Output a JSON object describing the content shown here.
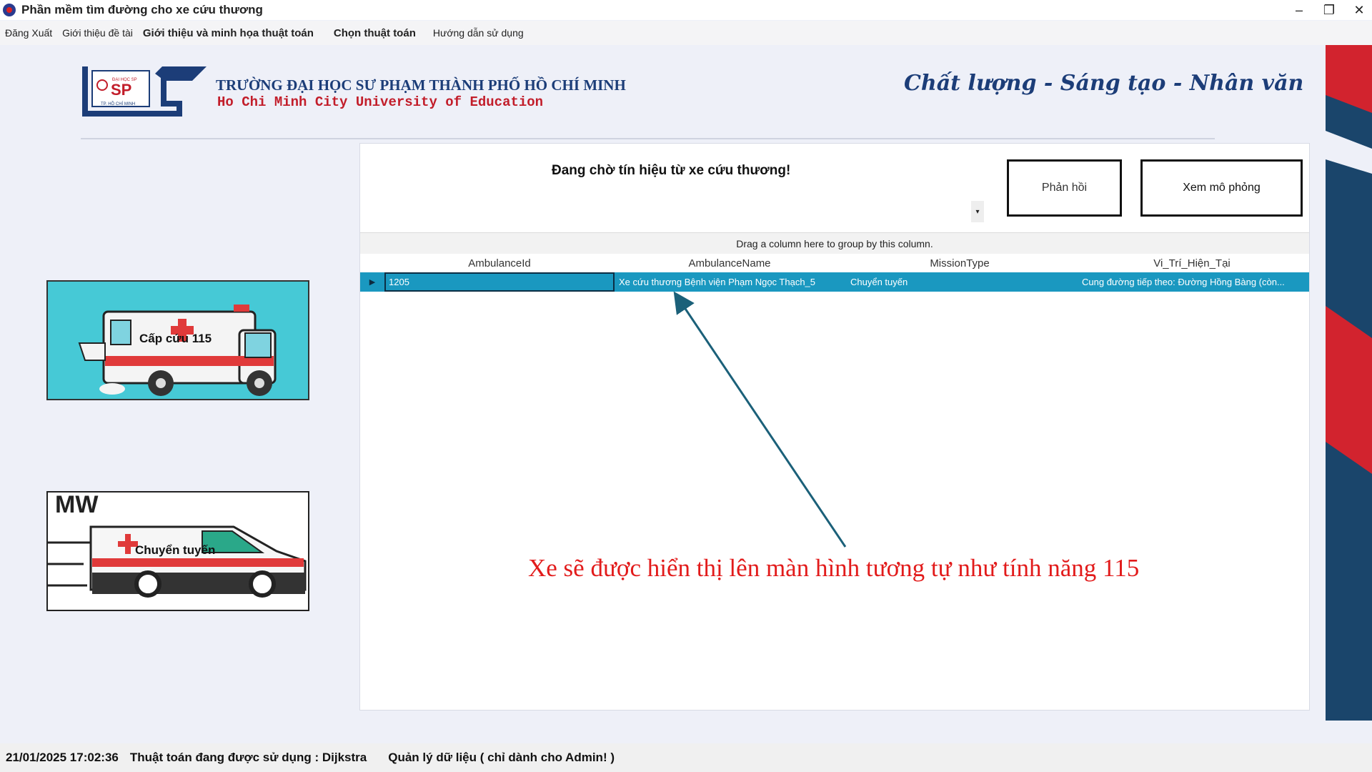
{
  "window": {
    "title": "Phần mềm tìm đường cho xe cứu thương",
    "controls": [
      "–",
      "❐",
      "✕"
    ]
  },
  "menu": {
    "items": [
      {
        "label": "Đăng Xuất",
        "bold": false
      },
      {
        "label": "Giới thiệu đề tài",
        "bold": false
      },
      {
        "label": "Giới thiệu và minh họa thuật toán",
        "bold": true
      },
      {
        "label": "Chọn thuật toán",
        "bold": true
      },
      {
        "label": "Hướng dẫn sử dụng",
        "bold": false
      }
    ]
  },
  "header": {
    "logo_text": "ĐẠI HỌC SP",
    "logo_sub": "TP. HỒ CHÍ MINH",
    "university_vn": "TRƯỜNG ĐẠI HỌC SƯ PHẠM THÀNH PHỐ HỒ CHÍ MINH",
    "university_en": "Ho Chi Minh City University of Education",
    "motto": "Chất lượng - Sáng tạo - Nhân văn"
  },
  "cards": {
    "emergency_label": "Cấp cứu 115",
    "transfer_label": "Chuyển tuyến",
    "transfer_banner": "MW"
  },
  "panel": {
    "status_message": "Đang chờ tín hiệu từ xe cứu thương!",
    "feedback_button": "Phản hồi",
    "simulate_button": "Xem mô phỏng",
    "dropdown_glyph": "▾"
  },
  "grid": {
    "group_hint": "Drag a column here to group by this column.",
    "columns": [
      "AmbulanceId",
      "AmbulanceName",
      "MissionType",
      "Vi_Trí_Hiện_Tại"
    ],
    "rows": [
      {
        "AmbulanceId": "1205",
        "AmbulanceName": "Xe cứu thương Bệnh viện Phạm Ngọc Thạch_5",
        "MissionType": "Chuyển tuyến",
        "Vi_Trí_Hiện_Tại": "Cung đường tiếp theo: Đường Hồng Bàng (còn..."
      }
    ]
  },
  "annotation": {
    "text": "Xe sẽ được hiển thị lên màn hình tương tự như tính năng 115"
  },
  "statusbar": {
    "datetime": "21/01/2025 17:02:36",
    "algorithm": "Thuật toán đang được sử dụng : Dijkstra",
    "admin": "Quản lý dữ liệu ( chỉ dành cho Admin! )"
  },
  "colors": {
    "selection": "#1a98c0",
    "annotation": "#e21b1b",
    "brand_blue": "#1c3d78",
    "brand_red": "#c21d2a"
  }
}
